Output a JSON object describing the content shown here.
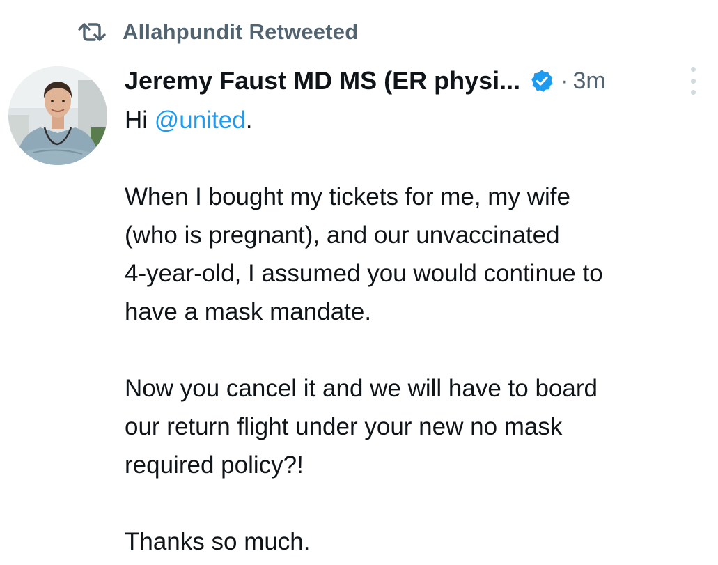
{
  "retweet": {
    "icon": "retweet-icon",
    "label": "Allahpundit Retweeted"
  },
  "author": {
    "avatar_icon": "profile-photo",
    "display_name": "Jeremy Faust MD MS (ER physi...",
    "verified_icon": "verified-badge-icon",
    "separator": "·",
    "time": "3m",
    "more_icon": "more-options-icon"
  },
  "tweet": {
    "greeting_prefix": "Hi ",
    "mention": "@united",
    "greeting_suffix": ".",
    "paragraph_1_line_1": "When I bought my tickets for me, my wife",
    "paragraph_1_line_2": "(who is pregnant), and our unvaccinated",
    "paragraph_1_line_3": "4-year-old, I assumed you would continue to",
    "paragraph_1_line_4": "have a mask mandate.",
    "paragraph_2_line_1": "Now you cancel it and we will have to board",
    "paragraph_2_line_2": "our return flight under your new no mask",
    "paragraph_2_line_3": "required policy?!",
    "paragraph_3_line_1": "Thanks so much."
  },
  "colors": {
    "accent": "#1d9bf0",
    "secondary_text": "#536471",
    "primary_text": "#0f1419"
  }
}
